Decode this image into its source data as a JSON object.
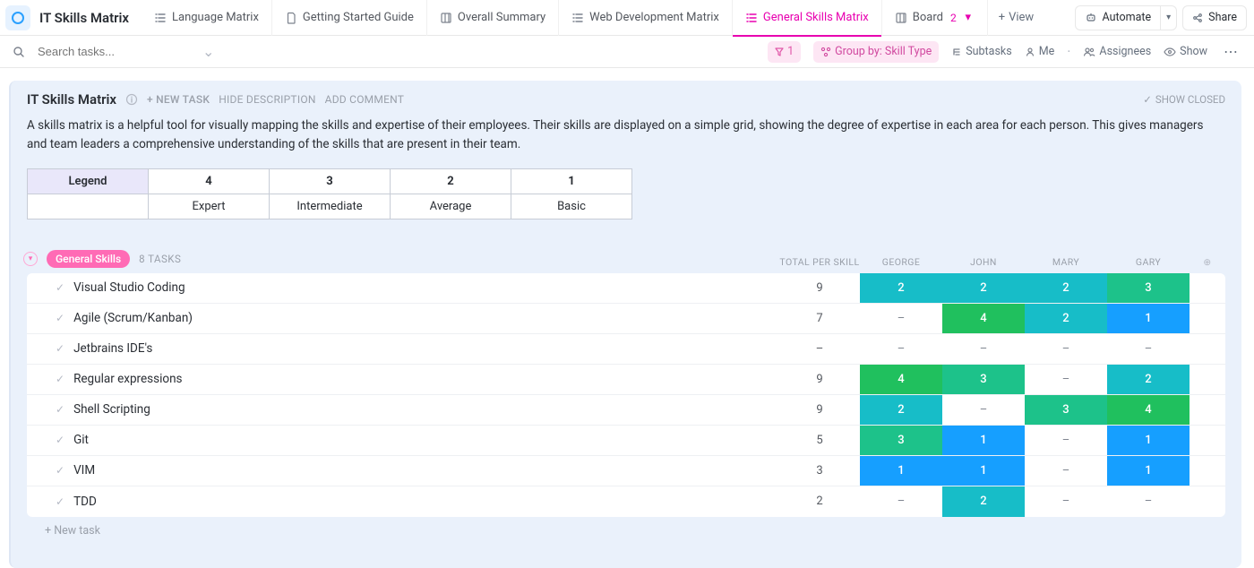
{
  "breadcrumb_title": "IT Skills Matrix",
  "tabs": [
    {
      "label": "Language Matrix"
    },
    {
      "label": "Getting Started Guide"
    },
    {
      "label": "Overall Summary"
    },
    {
      "label": "Web Development Matrix"
    },
    {
      "label": "General Skills Matrix"
    },
    {
      "label": "Board",
      "badge": "2"
    }
  ],
  "add_view": "View",
  "automate": "Automate",
  "share": "Share",
  "search_placeholder": "Search tasks...",
  "filter_count": "1",
  "group_by_label": "Group by: Skill Type",
  "subtasks": "Subtasks",
  "me": "Me",
  "assignees": "Assignees",
  "show": "Show",
  "panel": {
    "title": "IT Skills Matrix",
    "new_task": "+ NEW TASK",
    "hide_desc": "HIDE DESCRIPTION",
    "add_comment": "ADD COMMENT",
    "show_closed": "SHOW CLOSED",
    "description": "A skills matrix is a helpful tool for visually mapping the skills and expertise of their employees. Their skills are displayed on a simple grid, showing the degree of expertise in each area for each person. This gives managers and team leaders a comprehensive understanding of the skills that are present in their team."
  },
  "legend": {
    "header": "Legend",
    "cols": [
      "4",
      "3",
      "2",
      "1"
    ],
    "labels": [
      "Expert",
      "Intermediate",
      "Average",
      "Basic"
    ]
  },
  "group": {
    "name": "General Skills",
    "count": "8 TASKS",
    "columns": {
      "total": "TOTAL PER SKILL",
      "people": [
        "GEORGE",
        "JOHN",
        "MARY",
        "GARY"
      ]
    },
    "rows": [
      {
        "name": "Visual Studio Coding",
        "total": "9",
        "vals": [
          "2",
          "2",
          "2",
          "3"
        ]
      },
      {
        "name": "Agile (Scrum/Kanban)",
        "total": "7",
        "vals": [
          "–",
          "4",
          "2",
          "1"
        ]
      },
      {
        "name": "Jetbrains IDE's",
        "total": "–",
        "vals": [
          "–",
          "–",
          "–",
          "–"
        ]
      },
      {
        "name": "Regular expressions",
        "total": "9",
        "vals": [
          "4",
          "3",
          "–",
          "2"
        ]
      },
      {
        "name": "Shell Scripting",
        "total": "9",
        "vals": [
          "2",
          "–",
          "3",
          "4"
        ]
      },
      {
        "name": "Git",
        "total": "5",
        "vals": [
          "3",
          "1",
          "–",
          "1"
        ]
      },
      {
        "name": "VIM",
        "total": "3",
        "vals": [
          "1",
          "1",
          "–",
          "1"
        ]
      },
      {
        "name": "TDD",
        "total": "2",
        "vals": [
          "–",
          "2",
          "–",
          "–"
        ]
      }
    ],
    "new_task": "+ New task"
  }
}
